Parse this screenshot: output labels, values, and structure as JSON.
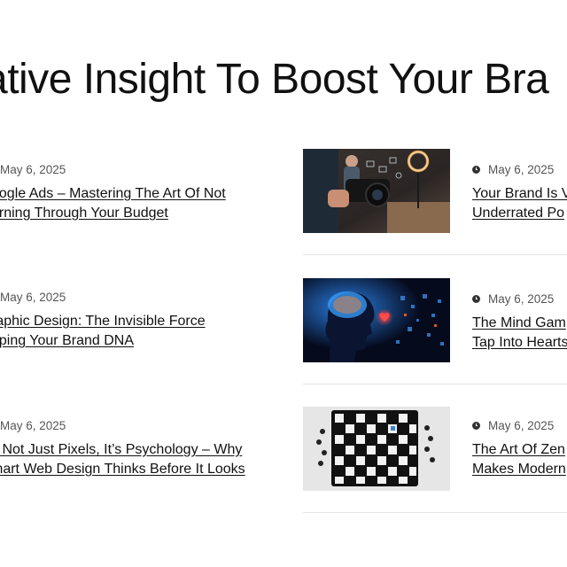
{
  "section": {
    "heading": "ative Insight To Boost Your Bra"
  },
  "left_posts": [
    {
      "date": "May 6, 2025",
      "title_line1": "oogle Ads – Mastering The Art Of Not",
      "title_line2": "urning Through Your Budget"
    },
    {
      "date": "May 6, 2025",
      "title_line1": "raphic Design: The Invisible Force",
      "title_line2": "aping Your Brand DNA"
    },
    {
      "date": "May 6, 2025",
      "title_line1": "s Not Just Pixels, It’s Psychology – Why",
      "title_line2": "mart Web Design Thinks Before It Looks"
    }
  ],
  "right_posts": [
    {
      "date": "May 6, 2025",
      "title_line1": "Your Brand Is V",
      "title_line2": "Underrated Po",
      "thumbnail": "camera-photographer-image"
    },
    {
      "date": "May 6, 2025",
      "title_line1": "The Mind Gam",
      "title_line2": "Tap Into Hearts",
      "thumbnail": "ai-brain-head-image"
    },
    {
      "date": "May 6, 2025",
      "title_line1": "The Art Of Zen",
      "title_line2": "Makes Modern",
      "thumbnail": "icon-grid-board-image"
    }
  ],
  "icons": {
    "date": "clock-icon"
  }
}
